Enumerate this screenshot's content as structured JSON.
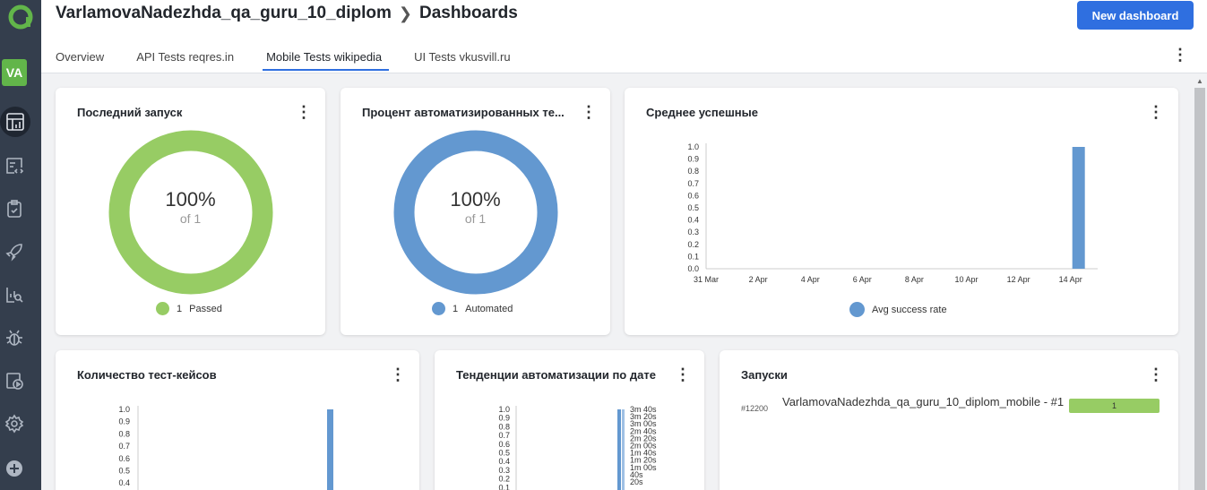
{
  "colors": {
    "passed": "#97cc64",
    "automated": "#6398d0",
    "primary": "#2f6fe0",
    "sidebar": "#343e4d"
  },
  "sidebar": {
    "avatar": "VA",
    "icons": [
      "allure-logo-icon",
      "dashboards-icon",
      "test-cases-icon",
      "test-plans-icon",
      "launches-icon",
      "analytics-icon",
      "defects-icon",
      "jobs-icon",
      "settings-icon",
      "add-icon"
    ]
  },
  "header": {
    "project": "VarlamovaNadezhda_qa_guru_10_diplom",
    "page": "Dashboards",
    "new_dashboard": "New dashboard",
    "tabs": [
      "Overview",
      "API Tests reqres.in",
      "Mobile Tests wikipedia",
      "UI Tests vkusvill.ru"
    ],
    "active_tab": 2
  },
  "widgets": {
    "last_launch": {
      "title": "Последний запуск",
      "percent": "100%",
      "of": "of 1",
      "legend_count": "1",
      "legend_label": "Passed"
    },
    "automated": {
      "title": "Процент автоматизированных те...",
      "percent": "100%",
      "of": "of 1",
      "legend_count": "1",
      "legend_label": "Automated"
    },
    "avg_success": {
      "title": "Среднее успешные",
      "legend_label": "Avg success rate"
    },
    "test_case_count": {
      "title": "Количество тест-кейсов"
    },
    "automation_trend": {
      "title": "Тенденции автоматизации по дате"
    },
    "launches": {
      "title": "Запуски",
      "id": "#12200",
      "name": "VarlamovaNadezhda_qa_guru_10_diplom_mobile - #1",
      "count": "1"
    }
  },
  "chart_data": [
    {
      "type": "bar",
      "series": [
        {
          "name": "Avg success rate",
          "x": [
            "14 Apr"
          ],
          "values": [
            1.0
          ]
        }
      ],
      "x_ticks": [
        "31 Mar",
        "2 Apr",
        "4 Apr",
        "6 Apr",
        "8 Apr",
        "10 Apr",
        "12 Apr",
        "14 Apr"
      ],
      "y_ticks": [
        "0.0",
        "0.1",
        "0.2",
        "0.3",
        "0.4",
        "0.5",
        "0.6",
        "0.7",
        "0.8",
        "0.9",
        "1.0"
      ],
      "ylim": [
        0,
        1.0
      ]
    },
    {
      "type": "bar",
      "values": [
        1.0
      ],
      "y_ticks": [
        "0.4",
        "0.5",
        "0.6",
        "0.7",
        "0.8",
        "0.9",
        "1.0"
      ],
      "ylim": [
        0,
        1.0
      ]
    },
    {
      "type": "bar",
      "values": [
        1.0
      ],
      "y_ticks": [
        "0.1",
        "0.2",
        "0.3",
        "0.4",
        "0.5",
        "0.6",
        "0.7",
        "0.8",
        "0.9",
        "1.0"
      ],
      "y2_ticks": [
        "20s",
        "40s",
        "1m 00s",
        "1m 20s",
        "1m 40s",
        "2m 00s",
        "2m 20s",
        "2m 40s",
        "3m 00s",
        "3m 20s",
        "3m 40s"
      ],
      "ylim": [
        0,
        1.0
      ]
    }
  ]
}
